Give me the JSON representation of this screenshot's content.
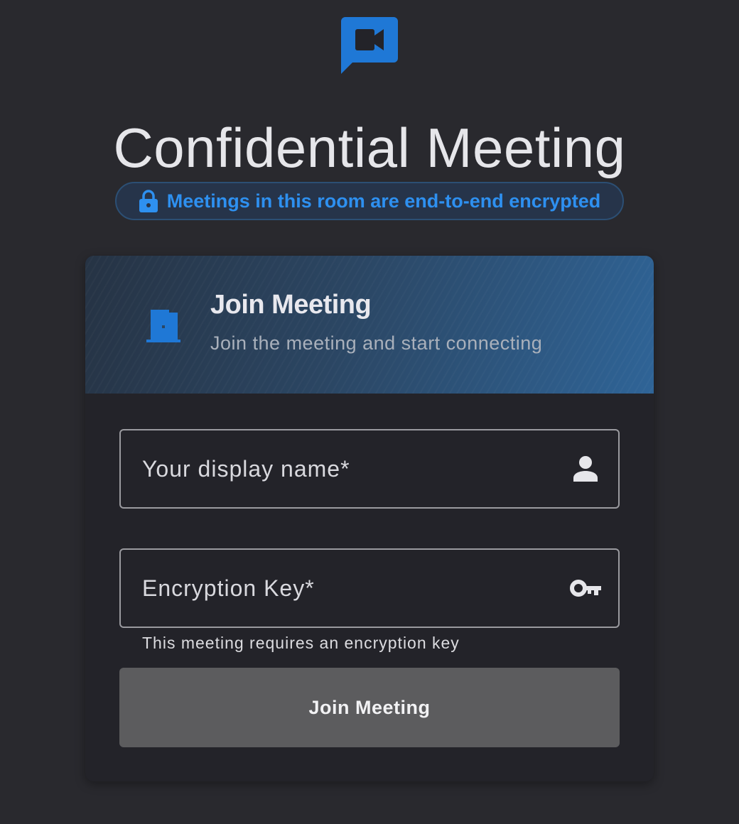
{
  "page": {
    "title": "Confidential Meeting",
    "encryption_badge": "Meetings in this room are end-to-end encrypted"
  },
  "card": {
    "header_title": "Join Meeting",
    "header_subtitle": "Join the meeting and start connecting"
  },
  "form": {
    "display_name": {
      "placeholder": "Your display name*",
      "value": ""
    },
    "encryption_key": {
      "placeholder": "Encryption Key*",
      "value": "",
      "helper": "This meeting requires an encryption key"
    },
    "join_label": "Join Meeting"
  },
  "icons": {
    "logo": "video-chat-icon",
    "badge": "lock-icon",
    "header": "door-icon",
    "name_field": "person-icon",
    "key_field": "key-icon"
  },
  "colors": {
    "accent": "#2e90f0",
    "background": "#29292e",
    "button": "#5c5c5e"
  }
}
